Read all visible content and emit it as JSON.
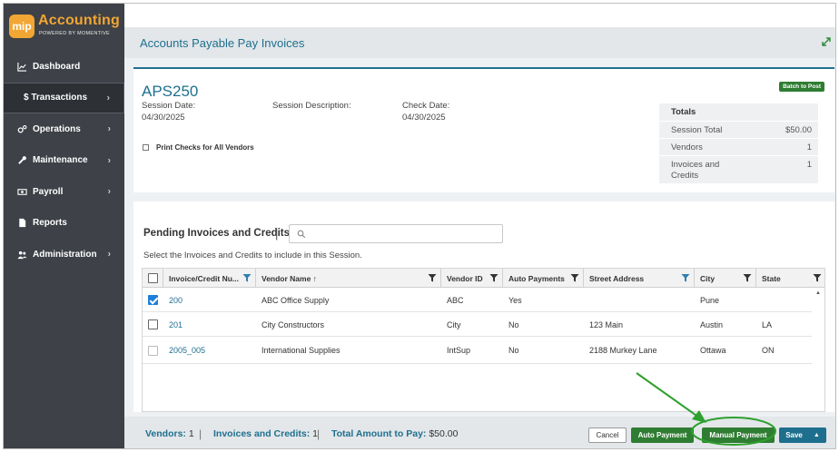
{
  "logo": {
    "badge": "mip",
    "title": "Accounting",
    "subtitle": "POWERED BY MOMENTIVE"
  },
  "nav": [
    {
      "label": "Dashboard",
      "icon": "chart-line-icon",
      "chevron": false
    },
    {
      "label": "$ Transactions",
      "icon": "",
      "chevron": true,
      "active": true
    },
    {
      "label": "Operations",
      "icon": "cogs-icon",
      "chevron": true
    },
    {
      "label": "Maintenance",
      "icon": "wrench-icon",
      "chevron": true
    },
    {
      "label": "Payroll",
      "icon": "money-icon",
      "chevron": true
    },
    {
      "label": "Reports",
      "icon": "document-icon",
      "chevron": false
    },
    {
      "label": "Administration",
      "icon": "users-icon",
      "chevron": true
    }
  ],
  "header": {
    "title": "Accounts Payable Pay Invoices"
  },
  "session": {
    "id": "APS250",
    "date_label": "Session Date:",
    "date_value": "04/30/2025",
    "desc_label": "Session Description:",
    "check_label": "Check Date:",
    "check_value": "04/30/2025",
    "batch_button": "Batch to Post",
    "print_checks_label": "Print Checks for All Vendors"
  },
  "totals": {
    "title": "Totals",
    "rows": [
      {
        "label": "Session Total",
        "value": "$50.00"
      },
      {
        "label": "Vendors",
        "value": "1"
      },
      {
        "label": "Invoices and Credits",
        "value": "1"
      }
    ]
  },
  "pending": {
    "title": "Pending Invoices and Credits",
    "separator": "|",
    "subtitle": "Select the Invoices and Credits to include in this Session.",
    "search_placeholder": ""
  },
  "grid": {
    "columns": [
      "Invoice/Credit Nu...",
      "Vendor Name ↑",
      "Vendor ID",
      "Auto Payments",
      "Street Address",
      "City",
      "State"
    ],
    "rows": [
      {
        "invoice": "200",
        "vendor": "ABC Office Supply",
        "vendor_id": "ABC",
        "auto": "Yes",
        "street": "",
        "city": "Pune",
        "state": "",
        "checked": true
      },
      {
        "invoice": "201",
        "vendor": "City Constructors",
        "vendor_id": "City",
        "auto": "No",
        "street": "123 Main",
        "city": "Austin",
        "state": "LA",
        "checked": false
      },
      {
        "invoice": "2005_005",
        "vendor": "International Supplies",
        "vendor_id": "IntSup",
        "auto": "No",
        "street": "2188 Murkey Lane",
        "city": "Ottawa",
        "state": "ON",
        "checked": false,
        "disabled": true
      }
    ]
  },
  "footer": {
    "vendors_label": "Vendors:",
    "vendors_value": "1",
    "invoices_label": "Invoices and Credits:",
    "invoices_value": "1",
    "amount_label": "Total Amount to Pay:",
    "amount_value": "$50.00",
    "sep": "|",
    "cancel": "Cancel",
    "auto_payment": "Auto Payment",
    "manual_payment": "Manual Payment",
    "save": "Save"
  },
  "colors": {
    "accent": "#1e6f8e",
    "green": "#2e7d32",
    "sidebar": "#3e4147",
    "logo": "#f2a634",
    "annotation": "#2ea02e"
  }
}
